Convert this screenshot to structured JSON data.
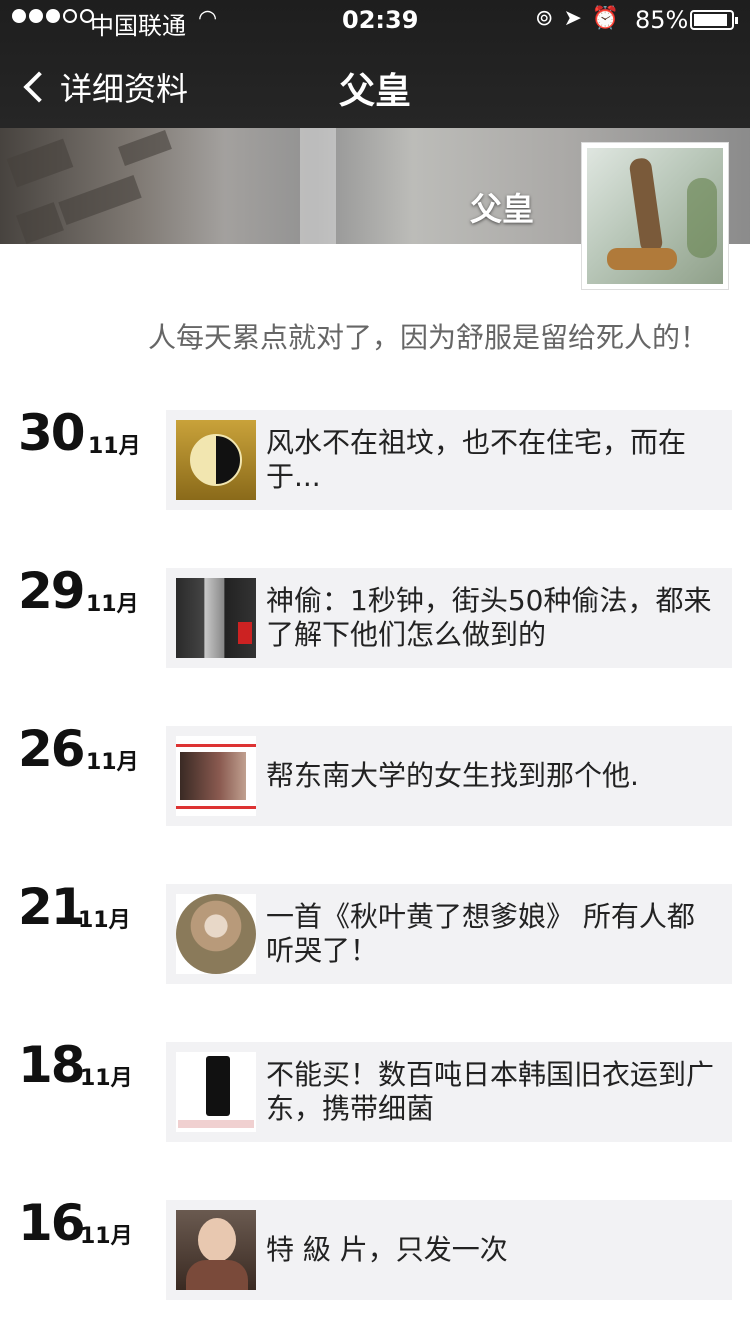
{
  "status": {
    "carrier": "中国联通",
    "time": "02:39",
    "battery": "85%"
  },
  "nav": {
    "back_label": "详细资料",
    "title": "父皇"
  },
  "profile": {
    "name": "父皇",
    "signature": "人每天累点就对了，因为舒服是留给死人的！"
  },
  "entries": [
    {
      "day": "30",
      "month": "11月",
      "text": "风水不在祖坟，也不在住宅，而在于..."
    },
    {
      "day": "29",
      "month": "11月",
      "text": "神偷：1秒钟，街头50种偷法，都来了解下他们怎么做到的"
    },
    {
      "day": "26",
      "month": "11月",
      "text": "帮东南大学的女生找到那个他."
    },
    {
      "day": "21",
      "month": "11月",
      "text": "一首《秋叶黄了想爹娘》 所有人都听哭了！"
    },
    {
      "day": "18",
      "month": "11月",
      "text": "不能买！数百吨日本韩国旧衣运到广东，携带细菌"
    },
    {
      "day": "16",
      "month": "11月",
      "text": "特 級 片，只发一次"
    }
  ],
  "icons": {
    "back": "chevron-left-icon",
    "wifi": "wifi-icon",
    "lock": "rotation-lock-icon",
    "location": "location-arrow-icon",
    "alarm": "alarm-icon",
    "battery": "battery-icon"
  }
}
